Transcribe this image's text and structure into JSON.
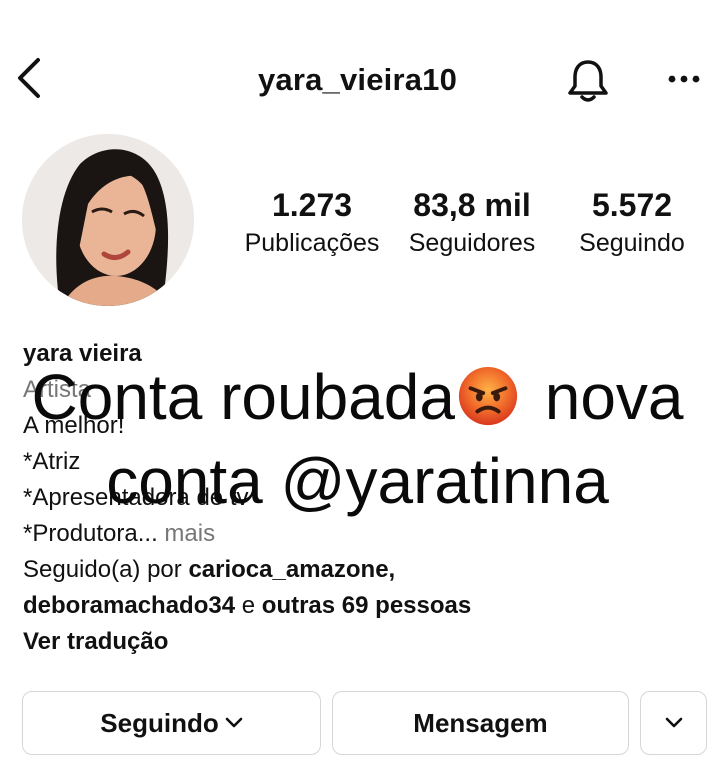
{
  "header": {
    "username": "yara_vieira10",
    "back_icon": "chevron-left-icon",
    "bell_icon": "bell-icon",
    "more_icon": "more-icon"
  },
  "stats": [
    {
      "value": "1.273",
      "label": "Publicações"
    },
    {
      "value": "83,8 mil",
      "label": "Seguidores"
    },
    {
      "value": "5.572",
      "label": "Seguindo"
    }
  ],
  "bio": {
    "name": "yara vieira",
    "category": "Artista",
    "lines": [
      "A melhor!",
      "*Atriz",
      "*Apresentadora de tv",
      "*Produtora..."
    ],
    "more_label": "mais",
    "followed_by_prefix": "Seguido(a) por",
    "followed_by_user1": "carioca_amazone,",
    "followed_by_user2": "deboramachado34",
    "followed_by_and": "e",
    "followed_by_others": "outras 69 pessoas",
    "translate_label": "Ver tradução"
  },
  "overlay": {
    "line1_text": "Conta roubada",
    "line1_after": " nova",
    "line2_text": "conta @yaratinna",
    "emoji": "angry-face-emoji"
  },
  "buttons": {
    "following_label": "Seguindo",
    "message_label": "Mensagem",
    "dropdown_icon": "chevron-down-icon"
  },
  "colors": {
    "text": "#111111",
    "muted": "#777777",
    "border": "#d6d6d6",
    "background": "#ffffff"
  }
}
